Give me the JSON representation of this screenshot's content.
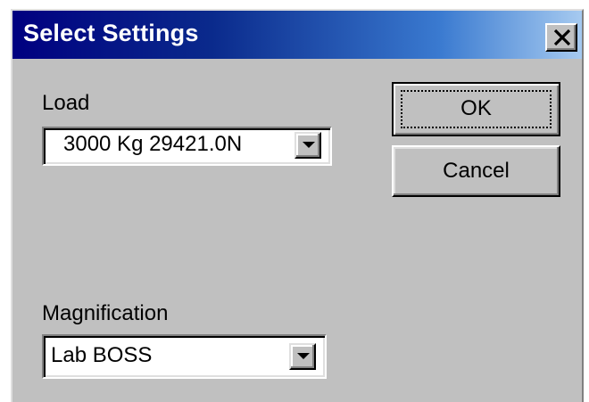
{
  "window": {
    "title": "Select Settings",
    "close_icon": "close-icon"
  },
  "load": {
    "label": "Load",
    "value": "3000 Kg  29421.0N"
  },
  "magnification": {
    "label": "Magnification",
    "value": "Lab BOSS"
  },
  "buttons": {
    "ok_label": "OK",
    "cancel_label": "Cancel"
  },
  "colors": {
    "face": "#c0c0c0",
    "title_start": "#000080",
    "title_end": "#a6caf0"
  }
}
